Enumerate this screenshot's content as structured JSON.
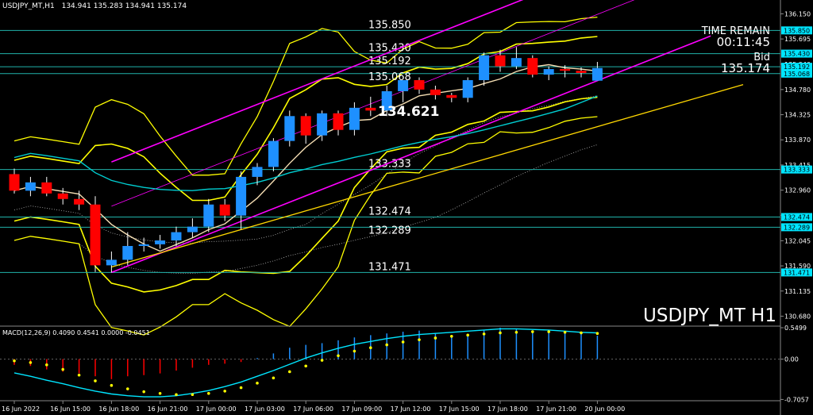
{
  "header": {
    "symbol_line": "USDJPY_MT,H1",
    "ohlc": "134.941 135.283 134.941 135.174"
  },
  "timer": {
    "label": "TIME REMAIN",
    "value": "00:11:45"
  },
  "bid": {
    "label": "Bid",
    "value": "135.174"
  },
  "watermark": "USDJPY_MT H1",
  "current_price_label": "134.621",
  "macd": {
    "header": "MACD(12,26,9) 0.4090 0.4541 0.0000 -0.0451",
    "axis_labels": [
      "0.5499",
      "0.00",
      "-0.7057"
    ]
  },
  "colors": {
    "background": "#000000",
    "bull_candle": "#1e90ff",
    "bear_candle": "#ff0000",
    "bollinger": "#ffff00",
    "channel": "#ff00ff",
    "level_line": "#20b2aa",
    "level_label": "#00e5ff",
    "ma_fast": "#f5deb3",
    "ma_slow": "#00ced1",
    "trend_line": "#ffd700",
    "macd_signal": "#ffff00",
    "macd_main": "#00e5ff"
  },
  "chart_data": {
    "type": "candlestick",
    "price_axis": {
      "range": [
        130.5,
        136.4
      ],
      "ticks": [
        "136.150",
        "135.695",
        "135.240",
        "134.780",
        "134.325",
        "133.870",
        "133.415",
        "132.960",
        "132.505",
        "132.045",
        "131.590",
        "131.135",
        "130.680"
      ]
    },
    "time_axis": {
      "labels": [
        "16 Jun 2022",
        "16 Jun 15:00",
        "16 Jun 18:00",
        "16 Jun 21:00",
        "17 Jun 00:00",
        "17 Jun 03:00",
        "17 Jun 06:00",
        "17 Jun 09:00",
        "17 Jun 12:00",
        "17 Jun 15:00",
        "17 Jun 18:00",
        "17 Jun 21:00",
        "20 Jun 00:00"
      ],
      "label_bars": [
        0,
        3,
        6,
        9,
        12,
        15,
        18,
        21,
        24,
        27,
        30,
        33,
        36
      ]
    },
    "levels": [
      {
        "value": 135.85,
        "label": "135.850"
      },
      {
        "value": 135.43,
        "label": "135.430"
      },
      {
        "value": 135.192,
        "label": "135.192"
      },
      {
        "value": 135.068,
        "label": "135.068"
      },
      {
        "value": 133.333,
        "label": "133.333"
      },
      {
        "value": 132.474,
        "label": "132.474"
      },
      {
        "value": 132.289,
        "label": "132.289"
      },
      {
        "value": 131.471,
        "label": "131.471"
      }
    ],
    "candles": [
      {
        "o": 133.25,
        "h": 133.35,
        "l": 132.9,
        "c": 132.95
      },
      {
        "o": 132.95,
        "h": 133.2,
        "l": 132.85,
        "c": 133.1
      },
      {
        "o": 133.1,
        "h": 133.2,
        "l": 132.85,
        "c": 132.9
      },
      {
        "o": 132.9,
        "h": 133.0,
        "l": 132.7,
        "c": 132.8
      },
      {
        "o": 132.8,
        "h": 132.95,
        "l": 132.6,
        "c": 132.7
      },
      {
        "o": 132.7,
        "h": 132.85,
        "l": 131.48,
        "c": 131.6
      },
      {
        "o": 131.6,
        "h": 131.85,
        "l": 131.47,
        "c": 131.7
      },
      {
        "o": 131.7,
        "h": 132.2,
        "l": 131.6,
        "c": 131.95
      },
      {
        "o": 131.95,
        "h": 132.1,
        "l": 131.85,
        "c": 131.98
      },
      {
        "o": 131.98,
        "h": 132.15,
        "l": 131.9,
        "c": 132.05
      },
      {
        "o": 132.05,
        "h": 132.3,
        "l": 131.95,
        "c": 132.2
      },
      {
        "o": 132.2,
        "h": 132.45,
        "l": 132.1,
        "c": 132.3
      },
      {
        "o": 132.3,
        "h": 132.8,
        "l": 132.2,
        "c": 132.7
      },
      {
        "o": 132.7,
        "h": 132.8,
        "l": 132.4,
        "c": 132.5
      },
      {
        "o": 132.5,
        "h": 133.3,
        "l": 132.25,
        "c": 133.2
      },
      {
        "o": 133.2,
        "h": 133.45,
        "l": 133.05,
        "c": 133.38
      },
      {
        "o": 133.38,
        "h": 133.9,
        "l": 133.3,
        "c": 133.85
      },
      {
        "o": 133.85,
        "h": 134.4,
        "l": 133.75,
        "c": 134.3
      },
      {
        "o": 134.3,
        "h": 134.35,
        "l": 133.8,
        "c": 133.95
      },
      {
        "o": 133.95,
        "h": 134.4,
        "l": 133.85,
        "c": 134.35
      },
      {
        "o": 134.35,
        "h": 134.4,
        "l": 133.95,
        "c": 134.05
      },
      {
        "o": 134.05,
        "h": 134.55,
        "l": 133.95,
        "c": 134.45
      },
      {
        "o": 134.45,
        "h": 134.65,
        "l": 134.3,
        "c": 134.4
      },
      {
        "o": 134.4,
        "h": 134.85,
        "l": 134.3,
        "c": 134.75
      },
      {
        "o": 134.75,
        "h": 134.9,
        "l": 134.55,
        "c": 134.95
      },
      {
        "o": 134.95,
        "h": 135.0,
        "l": 134.7,
        "c": 134.78
      },
      {
        "o": 134.78,
        "h": 134.85,
        "l": 134.6,
        "c": 134.68
      },
      {
        "o": 134.68,
        "h": 134.72,
        "l": 134.55,
        "c": 134.63
      },
      {
        "o": 134.63,
        "h": 135.0,
        "l": 134.55,
        "c": 134.95
      },
      {
        "o": 134.95,
        "h": 135.45,
        "l": 134.85,
        "c": 135.4
      },
      {
        "o": 135.4,
        "h": 135.5,
        "l": 135.1,
        "c": 135.2
      },
      {
        "o": 135.2,
        "h": 135.55,
        "l": 135.15,
        "c": 135.35
      },
      {
        "o": 135.35,
        "h": 135.4,
        "l": 135.0,
        "c": 135.05
      },
      {
        "o": 135.05,
        "h": 135.2,
        "l": 134.95,
        "c": 135.15
      },
      {
        "o": 135.15,
        "h": 135.22,
        "l": 135.0,
        "c": 135.12
      },
      {
        "o": 135.12,
        "h": 135.18,
        "l": 135.0,
        "c": 135.08
      },
      {
        "o": 134.94,
        "h": 135.28,
        "l": 134.94,
        "c": 135.17
      }
    ],
    "macd_histogram": [
      -0.1,
      -0.12,
      -0.18,
      -0.22,
      -0.25,
      -0.3,
      -0.35,
      -0.3,
      -0.28,
      -0.25,
      -0.2,
      -0.15,
      -0.1,
      -0.08,
      -0.05,
      0.02,
      0.1,
      0.2,
      0.25,
      0.28,
      0.33,
      0.38,
      0.42,
      0.45,
      0.48,
      0.5,
      0.46,
      0.42,
      0.44,
      0.5,
      0.55,
      0.53,
      0.5,
      0.48,
      0.46,
      0.44,
      0.41
    ],
    "macd_signal": [
      -0.03,
      -0.06,
      -0.1,
      -0.18,
      -0.28,
      -0.38,
      -0.46,
      -0.52,
      -0.57,
      -0.6,
      -0.62,
      -0.62,
      -0.6,
      -0.56,
      -0.5,
      -0.42,
      -0.33,
      -0.22,
      -0.12,
      -0.02,
      0.06,
      0.14,
      0.2,
      0.25,
      0.3,
      0.34,
      0.37,
      0.4,
      0.42,
      0.44,
      0.46,
      0.47,
      0.48,
      0.48,
      0.47,
      0.46,
      0.45
    ],
    "macd_main": [
      -0.24,
      -0.3,
      -0.37,
      -0.43,
      -0.5,
      -0.56,
      -0.61,
      -0.64,
      -0.66,
      -0.66,
      -0.64,
      -0.6,
      -0.55,
      -0.48,
      -0.4,
      -0.3,
      -0.2,
      -0.09,
      0.02,
      0.11,
      0.19,
      0.26,
      0.31,
      0.36,
      0.4,
      0.43,
      0.45,
      0.47,
      0.49,
      0.51,
      0.53,
      0.53,
      0.52,
      0.51,
      0.49,
      0.47,
      0.46
    ],
    "macd_range": [
      -0.7,
      0.55
    ]
  }
}
